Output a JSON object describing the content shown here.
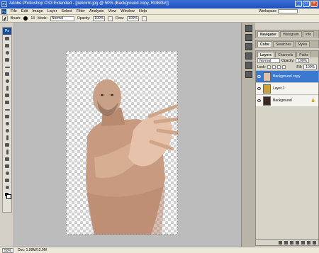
{
  "window": {
    "title": "Adobe Photoshop CS3 Extended - [pelicirm.jpg @ 50% (Background copy, RGB/8#)]",
    "app_icon_label": "Ps",
    "controls": [
      "minimize",
      "maximize",
      "close"
    ]
  },
  "menubar": {
    "items": [
      "File",
      "Edit",
      "Image",
      "Layer",
      "Select",
      "Filter",
      "Analysis",
      "View",
      "Window",
      "Help"
    ],
    "workspace_label": "Workspace"
  },
  "options_bar": {
    "brush_label": "Brush:",
    "brush_size": "13",
    "mode_label": "Mode:",
    "mode_value": "Normal",
    "opacity_label": "Opacity:",
    "opacity_value": "100%",
    "flow_label": "Flow:",
    "flow_value": "100%"
  },
  "toolbox": {
    "logo": "Ps",
    "foreground_color": "#000000",
    "background_color": "#ffffff"
  },
  "panels": {
    "navigator_tabs": [
      "Navigator",
      "Histogram",
      "Info"
    ],
    "color_tabs": [
      "Color",
      "Swatches",
      "Styles"
    ],
    "layers_tabs": [
      "Layers",
      "Channels",
      "Paths"
    ],
    "blend_mode": "Normal",
    "opacity_label": "Opacity:",
    "opacity_value": "100%",
    "lock_label": "Lock:",
    "fill_label": "Fill:",
    "fill_value": "100%",
    "layers": [
      {
        "name": "Background copy",
        "selected": true
      },
      {
        "name": "Layer 1",
        "selected": false
      },
      {
        "name": "Background",
        "selected": false
      }
    ]
  },
  "statusbar": {
    "zoom": "50%",
    "doc_info": "Doc: 1.99M/12.0M"
  },
  "colors": {
    "titlebar": "#1f4fb8",
    "selection": "#3b78cf",
    "workarea": "#bcbcbc"
  }
}
